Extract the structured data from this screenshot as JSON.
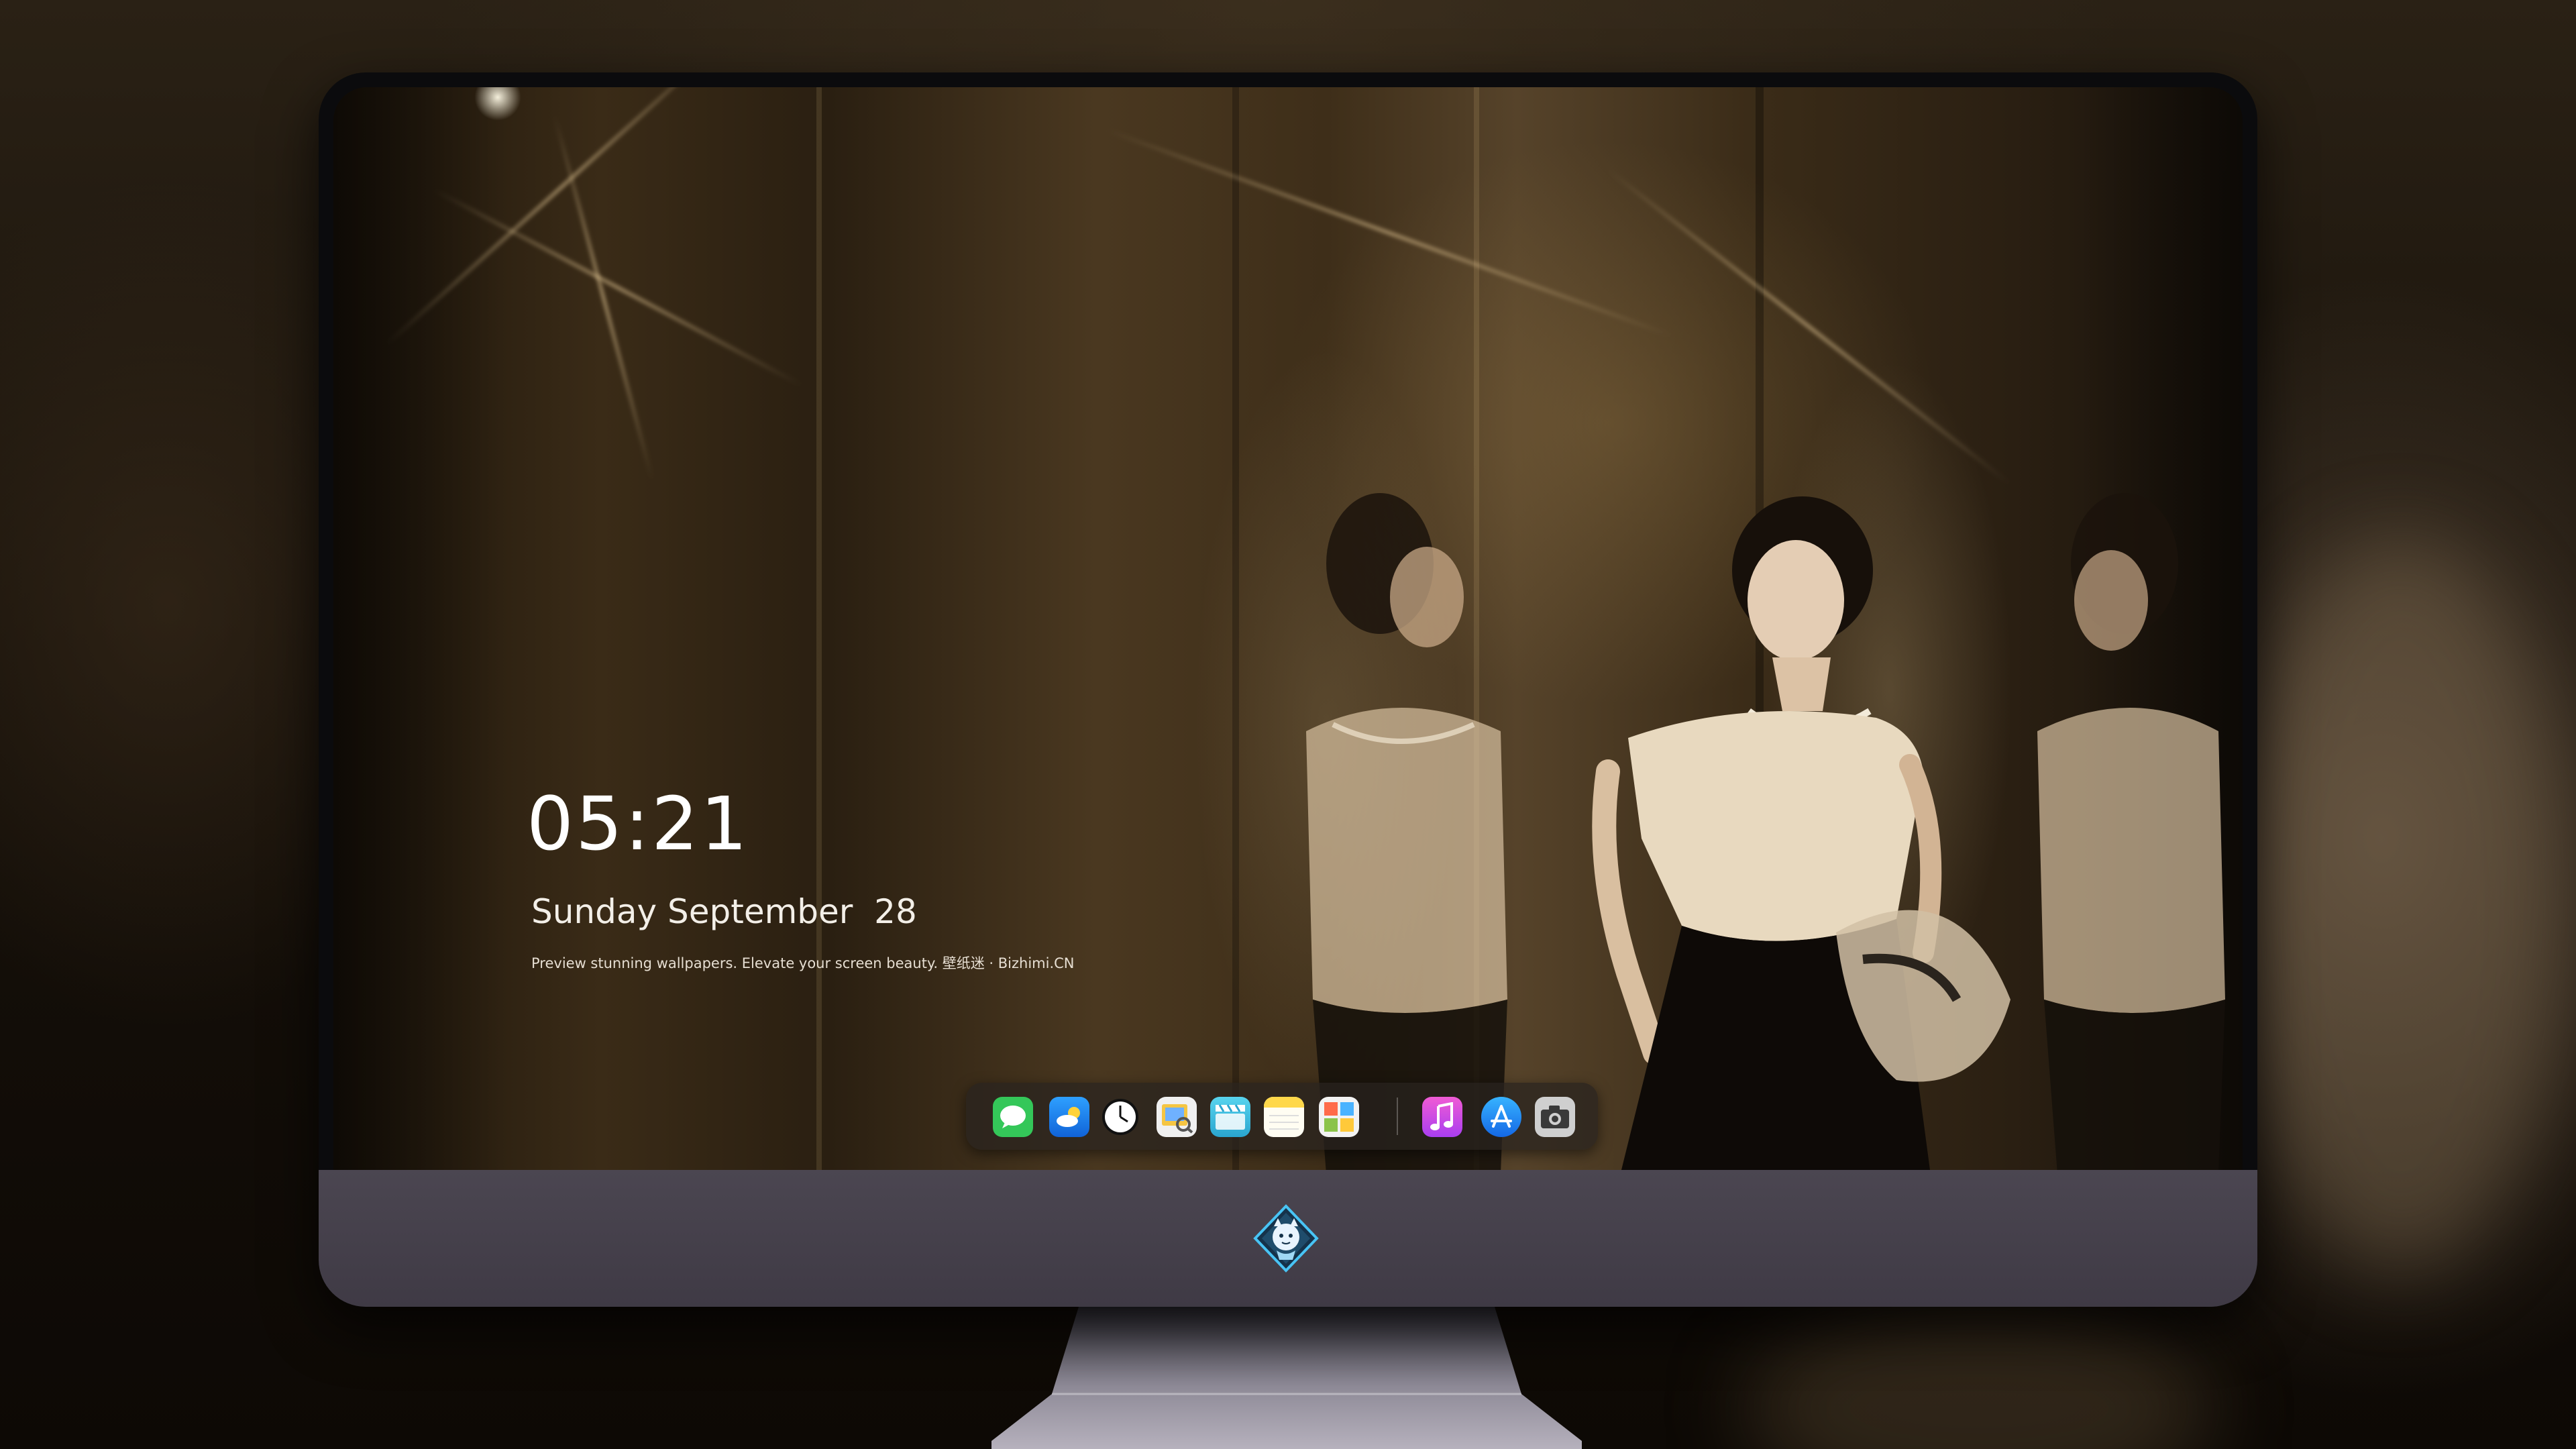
{
  "lock_screen": {
    "time": "05:21",
    "date": "Sunday September  28",
    "caption": "Preview stunning wallpapers. Elevate your screen beauty. 壁纸迷 · Bizhimi.CN"
  },
  "dock": {
    "apps": [
      {
        "name": "messages-icon",
        "color": "#34c759"
      },
      {
        "name": "weather-icon",
        "color": "#1e90ff"
      },
      {
        "name": "clock-icon",
        "color": "#ffffff"
      },
      {
        "name": "preview-icon",
        "color": "#f5c542"
      },
      {
        "name": "clips-icon",
        "color": "#49c6e5"
      },
      {
        "name": "notes-icon",
        "color": "#ffd84a"
      },
      {
        "name": "photo-booth-icon",
        "color": "#8bc34a"
      },
      {
        "name": "music-icon",
        "color": "#d946ef"
      },
      {
        "name": "app-store-icon",
        "color": "#1a8cff"
      },
      {
        "name": "camera-icon",
        "color": "#9e9e9e"
      }
    ]
  },
  "monitor": {
    "logo": "mascot-logo-icon",
    "bezel_color": "#0b0b0d",
    "chin_color": "#474250"
  }
}
